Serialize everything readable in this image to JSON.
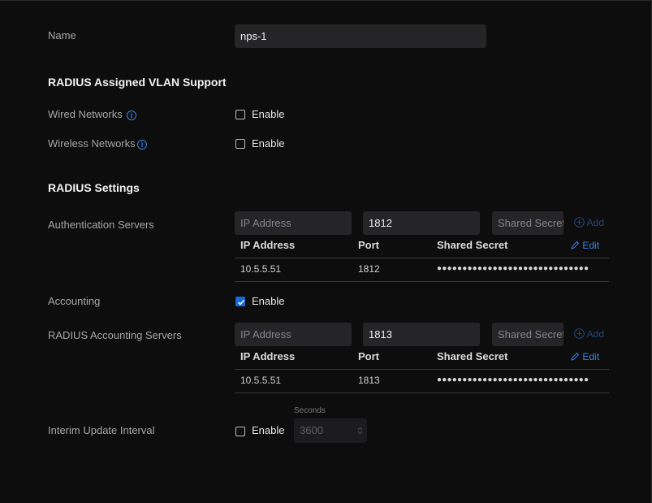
{
  "name_row": {
    "label": "Name",
    "value": "nps-1"
  },
  "vlan_section": {
    "title": "RADIUS Assigned VLAN Support",
    "wired_label": "Wired Networks",
    "wireless_label": "Wireless Networks",
    "enable_label": "Enable",
    "wired_checked": false,
    "wireless_checked": false
  },
  "radius_section": {
    "title": "RADIUS Settings"
  },
  "auth": {
    "label": "Authentication Servers",
    "ip_placeholder": "IP Address",
    "port_value": "1812",
    "secret_placeholder": "Shared Secret",
    "add_label": "Add",
    "columns": {
      "ip": "IP Address",
      "port": "Port",
      "secret": "Shared Secret"
    },
    "edit_label": "Edit",
    "rows": [
      {
        "ip": "10.5.5.51",
        "port": "1812",
        "secret": "●●●●●●●●●●●●●●●●●●●●●●●●●●●●●●"
      }
    ]
  },
  "accounting": {
    "label": "Accounting",
    "enable_label": "Enable",
    "checked": true
  },
  "acct": {
    "label": "RADIUS Accounting Servers",
    "ip_placeholder": "IP Address",
    "port_value": "1813",
    "secret_placeholder": "Shared Secret",
    "add_label": "Add",
    "columns": {
      "ip": "IP Address",
      "port": "Port",
      "secret": "Shared Secret"
    },
    "edit_label": "Edit",
    "rows": [
      {
        "ip": "10.5.5.51",
        "port": "1813",
        "secret": "●●●●●●●●●●●●●●●●●●●●●●●●●●●●●●"
      }
    ]
  },
  "interim": {
    "label": "Interim Update Interval",
    "enable_label": "Enable",
    "checked": false,
    "unit_label": "Seconds",
    "value": "3600"
  },
  "colors": {
    "accent": "#1669d9",
    "link": "#3b82e6",
    "background": "#0d0d0e",
    "input": "#252527"
  }
}
